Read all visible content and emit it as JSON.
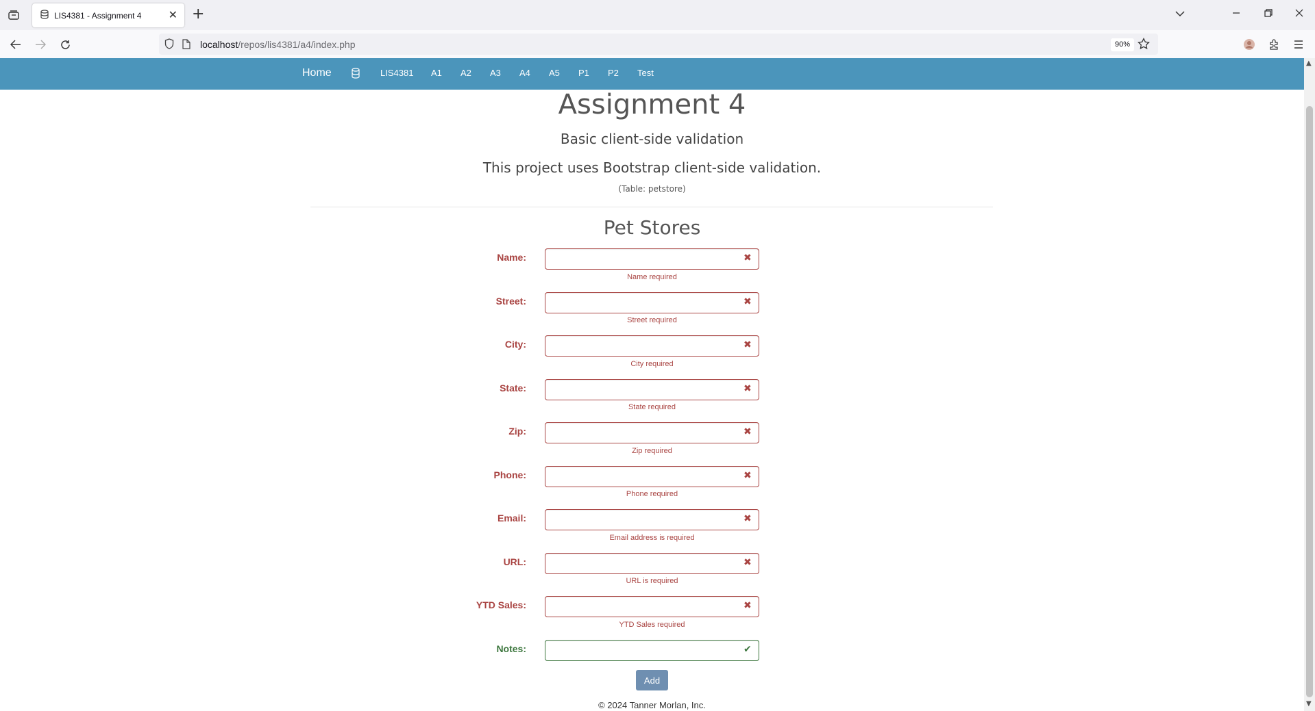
{
  "browser": {
    "tab_title": "LIS4381 - Assignment 4",
    "tab_close": "✕",
    "new_tab": "+",
    "url_host": "localhost",
    "url_path": "/repos/lis4381/a4/index.php",
    "zoom": "90%"
  },
  "site_nav": {
    "brand": "Home",
    "links": [
      "LIS4381",
      "A1",
      "A2",
      "A3",
      "A4",
      "A5",
      "P1",
      "P2",
      "Test"
    ]
  },
  "header": {
    "title": "Assignment 4",
    "subtitle": "Basic client-side validation",
    "description": "This project uses Bootstrap client-side validation.",
    "table_note": "(Table: petstore)"
  },
  "form": {
    "title": "Pet Stores",
    "fields": [
      {
        "label": "Name:",
        "value": "",
        "error": "Name required",
        "valid": false
      },
      {
        "label": "Street:",
        "value": "",
        "error": "Street required",
        "valid": false
      },
      {
        "label": "City:",
        "value": "",
        "error": "City required",
        "valid": false
      },
      {
        "label": "State:",
        "value": "",
        "error": "State required",
        "valid": false
      },
      {
        "label": "Zip:",
        "value": "",
        "error": "Zip required",
        "valid": false
      },
      {
        "label": "Phone:",
        "value": "",
        "error": "Phone required",
        "valid": false
      },
      {
        "label": "Email:",
        "value": "",
        "error": "Email address is required",
        "valid": false
      },
      {
        "label": "URL:",
        "value": "",
        "error": "URL is required",
        "valid": false
      },
      {
        "label": "YTD Sales:",
        "value": "",
        "error": "YTD Sales required",
        "valid": false
      },
      {
        "label": "Notes:",
        "value": "",
        "error": "",
        "valid": true
      }
    ],
    "submit_label": "Add"
  },
  "footer": {
    "text": "© 2024 Tanner Morlan, Inc."
  },
  "colors": {
    "nav_bg": "#4b95bb",
    "error": "#a94442",
    "success": "#3c763d",
    "button": "#6f8fb1"
  }
}
